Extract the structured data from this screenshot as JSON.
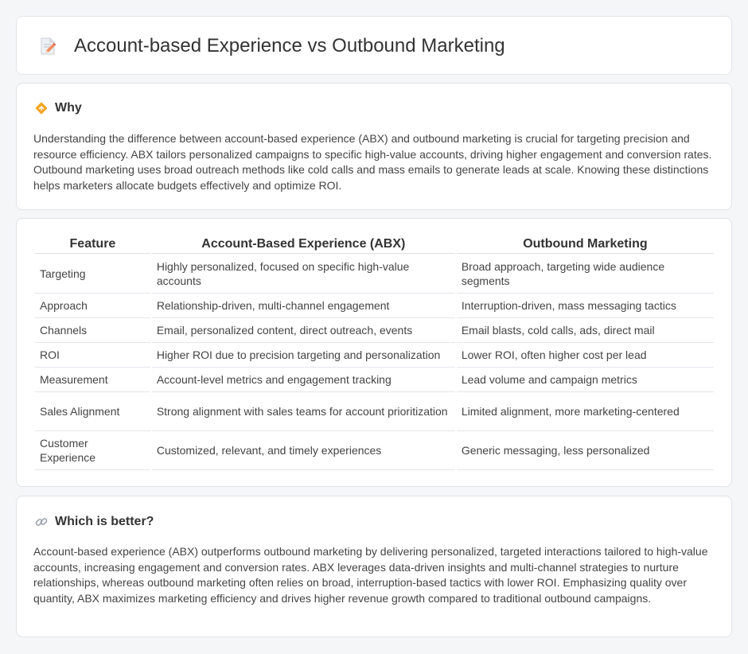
{
  "header": {
    "title": "Account-based Experience vs Outbound Marketing",
    "icon": "document-pencil-icon"
  },
  "why": {
    "icon": "diamond-sign-icon",
    "title": "Why",
    "text": "Understanding the difference between account-based experience (ABX) and outbound marketing is crucial for targeting precision and resource efficiency. ABX tailors personalized campaigns to specific high-value accounts, driving higher engagement and conversion rates. Outbound marketing uses broad outreach methods like cold calls and mass emails to generate leads at scale. Knowing these distinctions helps marketers allocate budgets effectively and optimize ROI."
  },
  "table": {
    "headers": [
      "Feature",
      "Account-Based Experience (ABX)",
      "Outbound Marketing"
    ],
    "rows": [
      [
        "Targeting",
        "Highly personalized, focused on specific high-value accounts",
        "Broad approach, targeting wide audience segments"
      ],
      [
        "Approach",
        "Relationship-driven, multi-channel engagement",
        "Interruption-driven, mass messaging tactics"
      ],
      [
        "Channels",
        "Email, personalized content, direct outreach, events",
        "Email blasts, cold calls, ads, direct mail"
      ],
      [
        "ROI",
        "Higher ROI due to precision targeting and personalization",
        "Lower ROI, often higher cost per lead"
      ],
      [
        "Measurement",
        "Account-level metrics and engagement tracking",
        "Lead volume and campaign metrics"
      ],
      [
        "Sales Alignment",
        "Strong alignment with sales teams for account prioritization",
        "Limited alignment, more marketing-centered"
      ],
      [
        "Customer Experience",
        "Customized, relevant, and timely experiences",
        "Generic messaging, less personalized"
      ]
    ]
  },
  "better": {
    "icon": "link-icon",
    "title": "Which is better?",
    "text": "Account-based experience (ABX) outperforms outbound marketing by delivering personalized, targeted interactions tailored to high-value accounts, increasing engagement and conversion rates. ABX leverages data-driven insights and multi-channel strategies to nurture relationships, whereas outbound marketing often relies on broad, interruption-based tactics with lower ROI. Emphasizing quality over quantity, ABX maximizes marketing efficiency and drives higher revenue growth compared to traditional outbound campaigns."
  }
}
